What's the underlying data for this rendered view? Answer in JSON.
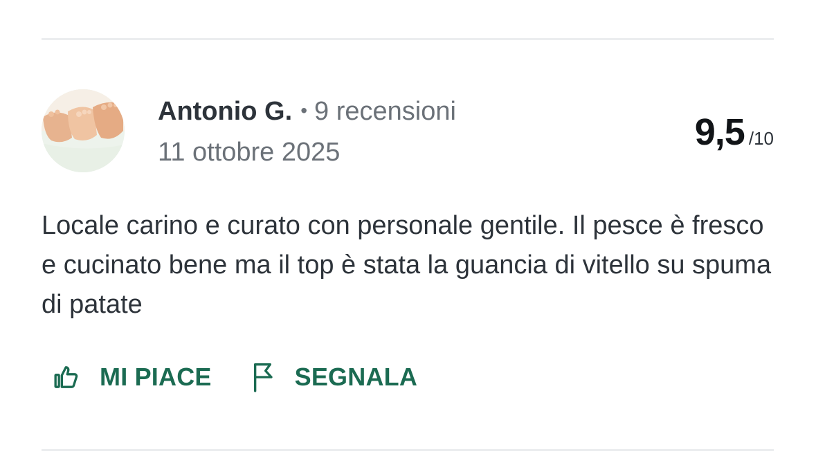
{
  "review": {
    "author": "Antonio G.",
    "separator": "•",
    "review_count": "9 recensioni",
    "date": "11 ottobre 2025",
    "score": "9,5",
    "score_max": "/10",
    "text": "Locale carino e curato con personale gentile. Il pesce è fresco e cucinato bene ma il top è stata la guancia di vitello su spuma di patate"
  },
  "actions": {
    "like_label": "MI PIACE",
    "report_label": "SEGNALA"
  },
  "icons": {
    "like": "thumbs-up-icon",
    "report": "flag-icon"
  },
  "colors": {
    "accent": "#1b6b52",
    "text_primary": "#2d333a",
    "text_secondary": "#6b7178",
    "divider": "#ebedef"
  }
}
